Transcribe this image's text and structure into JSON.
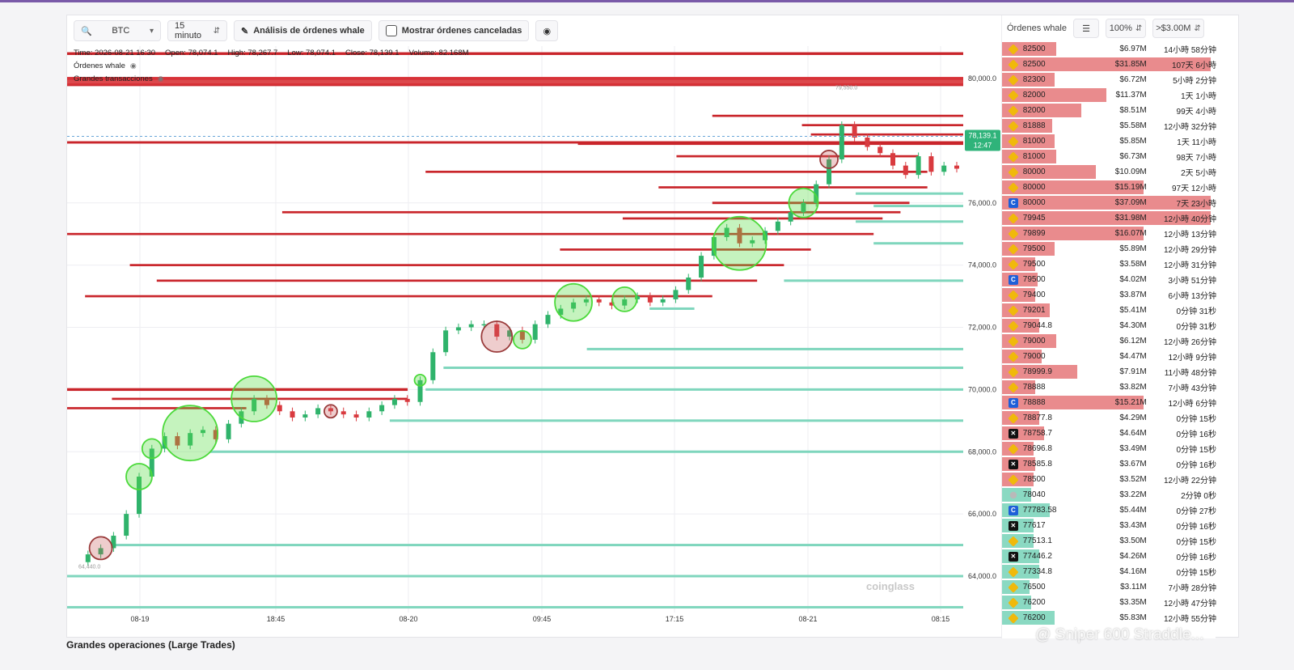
{
  "toolbar": {
    "search_value": "BTC",
    "interval": "15 minuto",
    "analysis_label": "Análisis de órdenes whale",
    "cancelled_label": "Mostrar órdenes canceladas"
  },
  "chart_info": {
    "time": "Time: 2026-08-21 16:30",
    "open": "Open: 78,074.1",
    "high": "High: 78,267.7",
    "low": "Low: 78,074.1",
    "close": "Close: 78,139.1",
    "volume": "Volume: 82.168M",
    "legend_whale": "Órdenes whale",
    "legend_large": "Grandes transacciones"
  },
  "chart_data": {
    "type": "candlestick",
    "ylim": [
      63000,
      81000
    ],
    "y_ticks": [
      "80,000.0",
      "76,000.0",
      "74,000.0",
      "72,000.0",
      "70,000.0",
      "68,000.0",
      "66,000.0",
      "64,000.0"
    ],
    "y_tick_values": [
      80000,
      76000,
      74000,
      72000,
      70000,
      68000,
      66000,
      64000
    ],
    "x_ticks": [
      "08-19",
      "18:45",
      "08-20",
      "09:45",
      "17:15",
      "08-21",
      "08:15"
    ],
    "current_price": "78,139.1",
    "current_countdown": "12:47",
    "current_value": 78139.1,
    "high_label": "79,550.0",
    "low_label": "64,440.0",
    "path": [
      64450,
      64700,
      64900,
      65300,
      66000,
      67200,
      68100,
      68500,
      68200,
      68600,
      68700,
      68400,
      68900,
      69300,
      69700,
      69500,
      69300,
      69100,
      69200,
      69400,
      69300,
      69200,
      69100,
      69300,
      69500,
      69700,
      69600,
      70300,
      71200,
      71900,
      72000,
      72100,
      72100,
      71700,
      71900,
      71600,
      72100,
      72400,
      72600,
      72800,
      72900,
      72800,
      72700,
      72900,
      73000,
      72800,
      72900,
      73200,
      73600,
      74300,
      74900,
      75200,
      74700,
      74800,
      75100,
      75400,
      75700,
      76000,
      76600,
      77400,
      78500,
      78100,
      77800,
      77600,
      77200,
      76900,
      77500,
      77000,
      77200,
      77100
    ],
    "ask_walls": [
      {
        "price": 80000,
        "from": 0.0,
        "to": 1.0,
        "w": 1
      },
      {
        "price": 80800,
        "from": 0.0,
        "to": 1.0,
        "w": 1
      },
      {
        "price": 79800,
        "from": 0.0,
        "to": 1.0,
        "w": 1
      },
      {
        "price": 78800,
        "from": 0.72,
        "to": 1.0,
        "w": 0.7
      },
      {
        "price": 78500,
        "from": 0.82,
        "to": 1.0,
        "w": 0.7
      },
      {
        "price": 78200,
        "from": 0.83,
        "to": 1.0,
        "w": 0.7
      },
      {
        "price": 77945,
        "from": 0.0,
        "to": 1.0,
        "w": 0.8
      },
      {
        "price": 77899,
        "from": 0.57,
        "to": 1.0,
        "w": 0.7
      },
      {
        "price": 77500,
        "from": 0.68,
        "to": 0.95,
        "w": 0.7
      },
      {
        "price": 77000,
        "from": 0.4,
        "to": 0.96,
        "w": 0.7
      },
      {
        "price": 76500,
        "from": 0.66,
        "to": 0.96,
        "w": 0.7
      },
      {
        "price": 76000,
        "from": 0.72,
        "to": 0.94,
        "w": 0.8
      },
      {
        "price": 75700,
        "from": 0.24,
        "to": 0.93,
        "w": 0.7
      },
      {
        "price": 75500,
        "from": 0.62,
        "to": 0.91,
        "w": 0.7
      },
      {
        "price": 75000,
        "from": 0.0,
        "to": 0.9,
        "w": 0.7
      },
      {
        "price": 74500,
        "from": 0.55,
        "to": 0.83,
        "w": 0.7
      },
      {
        "price": 74000,
        "from": 0.07,
        "to": 0.8,
        "w": 0.7
      },
      {
        "price": 73500,
        "from": 0.1,
        "to": 0.77,
        "w": 0.7
      },
      {
        "price": 73000,
        "from": 0.02,
        "to": 0.72,
        "w": 0.7
      },
      {
        "price": 70000,
        "from": 0.0,
        "to": 0.38,
        "w": 1
      },
      {
        "price": 69700,
        "from": 0.05,
        "to": 0.38,
        "w": 0.7
      },
      {
        "price": 69400,
        "from": 0.0,
        "to": 0.2,
        "w": 0.7
      }
    ],
    "bid_walls": [
      {
        "price": 76300,
        "from": 0.88,
        "to": 1.0
      },
      {
        "price": 75900,
        "from": 0.9,
        "to": 1.0
      },
      {
        "price": 75400,
        "from": 0.88,
        "to": 1.0
      },
      {
        "price": 74700,
        "from": 0.9,
        "to": 1.0
      },
      {
        "price": 73500,
        "from": 0.8,
        "to": 1.0
      },
      {
        "price": 72600,
        "from": 0.65,
        "to": 0.7
      },
      {
        "price": 71300,
        "from": 0.58,
        "to": 1.0
      },
      {
        "price": 70700,
        "from": 0.42,
        "to": 1.0
      },
      {
        "price": 70000,
        "from": 0.4,
        "to": 1.0
      },
      {
        "price": 69000,
        "from": 0.36,
        "to": 1.0
      },
      {
        "price": 68000,
        "from": 0.16,
        "to": 1.0
      },
      {
        "price": 65000,
        "from": 0.05,
        "to": 1.0
      },
      {
        "price": 64000,
        "from": 0.0,
        "to": 1.0
      },
      {
        "price": 63000,
        "from": 0.0,
        "to": 1.0
      }
    ],
    "bubbles": [
      {
        "i": 2,
        "r": 14,
        "side": "sell"
      },
      {
        "i": 5,
        "r": 16,
        "side": "buy"
      },
      {
        "i": 6,
        "r": 12,
        "side": "buy"
      },
      {
        "i": 9,
        "r": 34,
        "side": "buy"
      },
      {
        "i": 14,
        "r": 28,
        "side": "buy"
      },
      {
        "i": 20,
        "r": 8,
        "side": "sell"
      },
      {
        "i": 27,
        "r": 7,
        "side": "buy"
      },
      {
        "i": 33,
        "r": 19,
        "side": "sell"
      },
      {
        "i": 35,
        "r": 11,
        "side": "buy"
      },
      {
        "i": 39,
        "r": 23,
        "side": "buy"
      },
      {
        "i": 43,
        "r": 15,
        "side": "buy"
      },
      {
        "i": 52,
        "r": 33,
        "side": "buy"
      },
      {
        "i": 57,
        "r": 18,
        "side": "buy"
      },
      {
        "i": 59,
        "r": 11,
        "side": "sell"
      }
    ]
  },
  "side": {
    "title": "Órdenes whale",
    "zoom": "100%",
    "min_filter": ">$3.00M",
    "rows": [
      {
        "ex": "b",
        "price": "82500",
        "amt": "$6.97M",
        "dur": "14小時 58分钟",
        "side": "ask",
        "w": 0.26
      },
      {
        "ex": "b",
        "price": "82500",
        "amt": "$31.85M",
        "dur": "107天 6小時",
        "side": "ask",
        "w": 1.0
      },
      {
        "ex": "b",
        "price": "82300",
        "amt": "$6.72M",
        "dur": "5小時 2分钟",
        "side": "ask",
        "w": 0.25
      },
      {
        "ex": "b",
        "price": "82000",
        "amt": "$11.37M",
        "dur": "1天 1小時",
        "side": "ask",
        "w": 0.5
      },
      {
        "ex": "b",
        "price": "82000",
        "amt": "$8.51M",
        "dur": "99天 4小時",
        "side": "ask",
        "w": 0.38
      },
      {
        "ex": "b",
        "price": "81888",
        "amt": "$5.58M",
        "dur": "12小時 32分钟",
        "side": "ask",
        "w": 0.24
      },
      {
        "ex": "b",
        "price": "81000",
        "amt": "$5.85M",
        "dur": "1天 11小時",
        "side": "ask",
        "w": 0.25
      },
      {
        "ex": "b",
        "price": "81000",
        "amt": "$6.73M",
        "dur": "98天 7小時",
        "side": "ask",
        "w": 0.26
      },
      {
        "ex": "b",
        "price": "80000",
        "amt": "$10.09M",
        "dur": "2天 5小時",
        "side": "ask",
        "w": 0.45
      },
      {
        "ex": "b",
        "price": "80000",
        "amt": "$15.19M",
        "dur": "97天 12小時",
        "side": "ask",
        "w": 0.68
      },
      {
        "ex": "c",
        "price": "80000",
        "amt": "$37.09M",
        "dur": "7天 23小時",
        "side": "ask",
        "w": 1.0
      },
      {
        "ex": "b",
        "price": "79945",
        "amt": "$31.98M",
        "dur": "12小時 40分钟",
        "side": "ask",
        "w": 1.0
      },
      {
        "ex": "b",
        "price": "79899",
        "amt": "$16.07M",
        "dur": "12小時 13分钟",
        "side": "ask",
        "w": 0.68
      },
      {
        "ex": "b",
        "price": "79500",
        "amt": "$5.89M",
        "dur": "12小時 29分钟",
        "side": "ask",
        "w": 0.25
      },
      {
        "ex": "b",
        "price": "79500",
        "amt": "$3.58M",
        "dur": "12小時 31分钟",
        "side": "ask",
        "w": 0.16
      },
      {
        "ex": "c",
        "price": "79500",
        "amt": "$4.02M",
        "dur": "3小時 51分钟",
        "side": "ask",
        "w": 0.17
      },
      {
        "ex": "b",
        "price": "79400",
        "amt": "$3.87M",
        "dur": "6小時 13分钟",
        "side": "ask",
        "w": 0.16
      },
      {
        "ex": "b",
        "price": "79201",
        "amt": "$5.41M",
        "dur": "0分钟 31秒",
        "side": "ask",
        "w": 0.23
      },
      {
        "ex": "b",
        "price": "79044.8",
        "amt": "$4.30M",
        "dur": "0分钟 31秒",
        "side": "ask",
        "w": 0.18
      },
      {
        "ex": "b",
        "price": "79000",
        "amt": "$6.12M",
        "dur": "12小時 26分钟",
        "side": "ask",
        "w": 0.26
      },
      {
        "ex": "b",
        "price": "79000",
        "amt": "$4.47M",
        "dur": "12小時 9分钟",
        "side": "ask",
        "w": 0.19
      },
      {
        "ex": "b",
        "price": "78999.9",
        "amt": "$7.91M",
        "dur": "11小時 48分钟",
        "side": "ask",
        "w": 0.36
      },
      {
        "ex": "b",
        "price": "78888",
        "amt": "$3.82M",
        "dur": "7小時 43分钟",
        "side": "ask",
        "w": 0.16
      },
      {
        "ex": "c",
        "price": "78888",
        "amt": "$15.21M",
        "dur": "12小時 6分钟",
        "side": "ask",
        "w": 0.68
      },
      {
        "ex": "b",
        "price": "78877.8",
        "amt": "$4.29M",
        "dur": "0分钟 15秒",
        "side": "ask",
        "w": 0.18
      },
      {
        "ex": "x",
        "price": "78758.7",
        "amt": "$4.64M",
        "dur": "0分钟 16秒",
        "side": "ask",
        "w": 0.2
      },
      {
        "ex": "b",
        "price": "78696.8",
        "amt": "$3.49M",
        "dur": "0分钟 15秒",
        "side": "ask",
        "w": 0.15
      },
      {
        "ex": "x",
        "price": "78585.8",
        "amt": "$3.67M",
        "dur": "0分钟 16秒",
        "side": "ask",
        "w": 0.16
      },
      {
        "ex": "b",
        "price": "78500",
        "amt": "$3.52M",
        "dur": "12小時 22分钟",
        "side": "ask",
        "w": 0.15
      },
      {
        "ex": "p",
        "price": "78040",
        "amt": "$3.22M",
        "dur": "2分钟 0秒",
        "side": "bid",
        "w": 0.14
      },
      {
        "ex": "c",
        "price": "77783.58",
        "amt": "$5.44M",
        "dur": "0分钟 27秒",
        "side": "bid",
        "w": 0.23
      },
      {
        "ex": "x",
        "price": "77617",
        "amt": "$3.43M",
        "dur": "0分钟 16秒",
        "side": "bid",
        "w": 0.15
      },
      {
        "ex": "b",
        "price": "77513.1",
        "amt": "$3.50M",
        "dur": "0分钟 15秒",
        "side": "bid",
        "w": 0.15
      },
      {
        "ex": "x",
        "price": "77446.2",
        "amt": "$4.26M",
        "dur": "0分钟 16秒",
        "side": "bid",
        "w": 0.18
      },
      {
        "ex": "b",
        "price": "77334.8",
        "amt": "$4.16M",
        "dur": "0分钟 15秒",
        "side": "bid",
        "w": 0.18
      },
      {
        "ex": "b",
        "price": "76500",
        "amt": "$3.11M",
        "dur": "7小時 28分钟",
        "side": "bid",
        "w": 0.13
      },
      {
        "ex": "b",
        "price": "76200",
        "amt": "$3.35M",
        "dur": "12小時 47分钟",
        "side": "bid",
        "w": 0.14
      },
      {
        "ex": "b",
        "price": "76200",
        "amt": "$5.83M",
        "dur": "12小時 55分钟",
        "side": "bid",
        "w": 0.25
      }
    ]
  },
  "footer": {
    "title": "Grandes operaciones (Large Trades)",
    "watermark": "coinglass",
    "overlay": "@ Sniper 600  Straddle..."
  }
}
